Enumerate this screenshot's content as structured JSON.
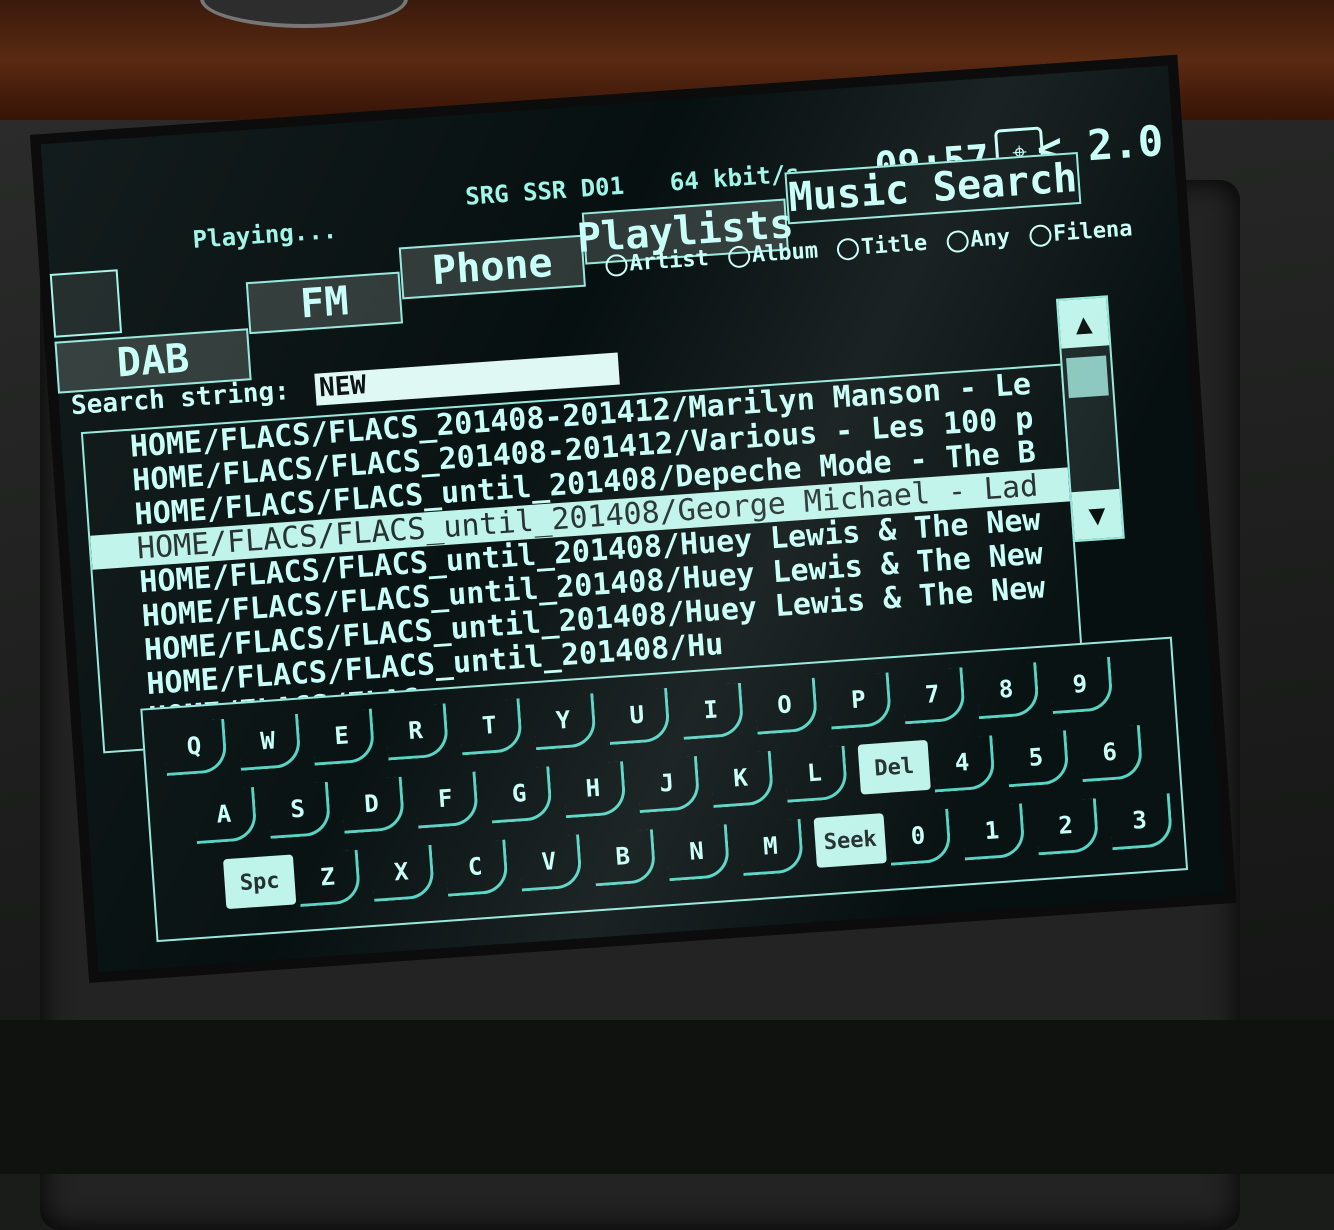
{
  "status": {
    "playing": "Playing...",
    "station": "SRG SSR D01",
    "bitrate": "64 kbit/s",
    "time": "09:57",
    "zoom": "< 2.0"
  },
  "tabs": {
    "dab": "DAB",
    "fm": "FM",
    "phone": "Phone",
    "playlists": "Playlists",
    "music_search": "Music Search"
  },
  "filters": {
    "options": [
      "Artist",
      "Album",
      "Title",
      "Any",
      "Filena"
    ]
  },
  "search": {
    "label": "Search string:",
    "value": "NEW"
  },
  "results": [
    "HOME/FLACS/FLACS_201408-201412/Marilyn Manson - Le",
    "HOME/FLACS/FLACS_201408-201412/Various - Les 100 p",
    "HOME/FLACS/FLACS_until_201408/Depeche Mode - The B",
    "HOME/FLACS/FLACS_until_201408/George Michael - Lad",
    "HOME/FLACS/FLACS_until_201408/Huey Lewis & The New",
    "HOME/FLACS/FLACS_until_201408/Huey Lewis & The New",
    "HOME/FLACS/FLACS_until_201408/Huey Lewis & The New",
    "HOME/FLACS/FLACS_until_201408/Hu",
    "HOME/FLACS/FLAC"
  ],
  "selected_index": 3,
  "keyboard": {
    "row1": [
      "Q",
      "W",
      "E",
      "R",
      "T",
      "Y",
      "U",
      "I",
      "O",
      "P",
      "7",
      "8",
      "9"
    ],
    "row2": [
      "A",
      "S",
      "D",
      "F",
      "G",
      "H",
      "J",
      "K",
      "L",
      "Del",
      "4",
      "5",
      "6"
    ],
    "row3": [
      "Spc",
      "Z",
      "X",
      "C",
      "V",
      "B",
      "N",
      "M",
      "Seek",
      "0",
      "1",
      "2",
      "3"
    ]
  },
  "colors": {
    "screen_bg": "#071010",
    "text": "#c8fff8",
    "accent": "#96e8dc",
    "selected_row": "#bff4ea"
  }
}
